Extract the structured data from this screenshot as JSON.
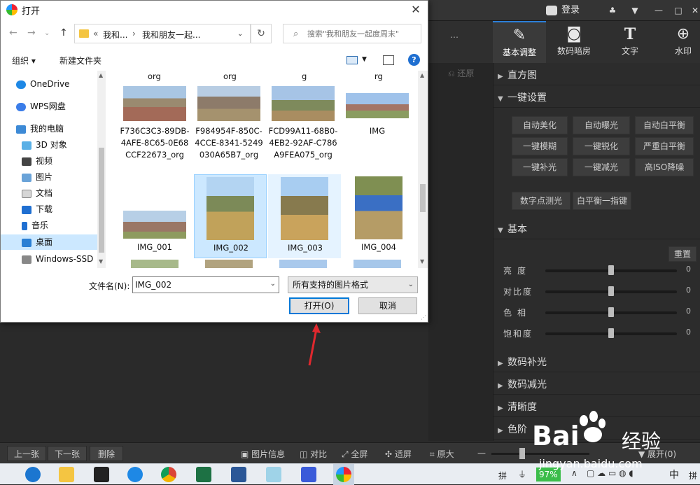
{
  "dialog": {
    "title": "打开",
    "address": {
      "seg1_prefix": "«",
      "seg1": "我和...",
      "sep": "›",
      "seg2": "我和朋友一起..."
    },
    "search_placeholder": "搜索\"我和朋友一起度周末\"",
    "organize": "组织 ▾",
    "new_folder": "新建文件夹",
    "nav": [
      {
        "label": "OneDrive",
        "icon": "onedrive-icon"
      },
      {
        "label": "WPS网盘",
        "icon": "wps-cloud-icon"
      },
      {
        "label": "我的电脑",
        "icon": "computer-icon"
      },
      {
        "label": "3D 对象",
        "icon": "3d-objects-icon"
      },
      {
        "label": "视频",
        "icon": "video-icon"
      },
      {
        "label": "图片",
        "icon": "pictures-icon"
      },
      {
        "label": "文档",
        "icon": "documents-icon"
      },
      {
        "label": "下载",
        "icon": "downloads-icon"
      },
      {
        "label": "音乐",
        "icon": "music-icon"
      },
      {
        "label": "桌面",
        "icon": "desktop-icon"
      },
      {
        "label": "Windows-SSD",
        "icon": "drive-icon"
      }
    ],
    "top_fragments": [
      "org",
      "org",
      "g",
      "rg"
    ],
    "files_row1": [
      {
        "name": "F736C3C3-89DB-4AFE-8C65-0E68CCF22673_org"
      },
      {
        "name": "F984954F-850C-4CCE-8341-5249030A65B7_org"
      },
      {
        "name": "FCD99A11-68B0-4EB2-92AF-C786A9FEA075_org"
      },
      {
        "name": "IMG"
      }
    ],
    "files_row2": [
      {
        "name": "IMG_001"
      },
      {
        "name": "IMG_002"
      },
      {
        "name": "IMG_003"
      },
      {
        "name": "IMG_004"
      }
    ],
    "filename_label": "文件名(N):",
    "filename_value": "IMG_002",
    "filetype": "所有支持的图片格式",
    "open_label": "打开(O)",
    "cancel_label": "取消"
  },
  "app": {
    "login": "登录",
    "tools": [
      {
        "label": "基本调整",
        "icon": "edit-square-icon"
      },
      {
        "label": "数码暗房",
        "icon": "camera-icon"
      },
      {
        "label": "文字",
        "icon": "text-t-icon"
      },
      {
        "label": "水印",
        "icon": "watermark-icon"
      }
    ],
    "undo_label": "还原",
    "sections": {
      "histogram": "直方图",
      "one_click": "一键设置",
      "basic": "基本",
      "digital_fill": "数码补光",
      "digital_reduce": "数码减光",
      "sharpness": "清晰度",
      "levels": "色阶"
    },
    "one_click_buttons": [
      "自动美化",
      "自动曝光",
      "自动白平衡",
      "一键模糊",
      "一键锐化",
      "严重白平衡",
      "一键补光",
      "一键减光",
      "高ISO降噪"
    ],
    "extra_buttons": [
      "数字点测光",
      "白平衡一指键"
    ],
    "reset_label": "重置",
    "sliders": [
      {
        "label": "亮度",
        "value": "0",
        "level": 0.5
      },
      {
        "label": "对比度",
        "value": "0",
        "level": 0.5
      },
      {
        "label": "色相",
        "value": "0",
        "level": 0.5
      },
      {
        "label": "饱和度",
        "value": "0",
        "level": 0.5
      }
    ],
    "bottom": {
      "prev": "上一张",
      "next": "下一张",
      "delete": "删除",
      "info": "图片信息",
      "compare": "对比",
      "fullscreen": "全屏",
      "fit": "适屏",
      "original": "原大",
      "expand": "展开(0)"
    }
  },
  "taskbar": {
    "battery": "97%",
    "ime": "中",
    "ime2": "拼"
  },
  "watermark": {
    "brand": "Bai",
    "brand2": "经验",
    "url": "jingyan.baidu.com"
  },
  "colors": {
    "accent": "#0078d7",
    "selection": "#cce8ff",
    "annotation_arrow": "#e0282e"
  }
}
